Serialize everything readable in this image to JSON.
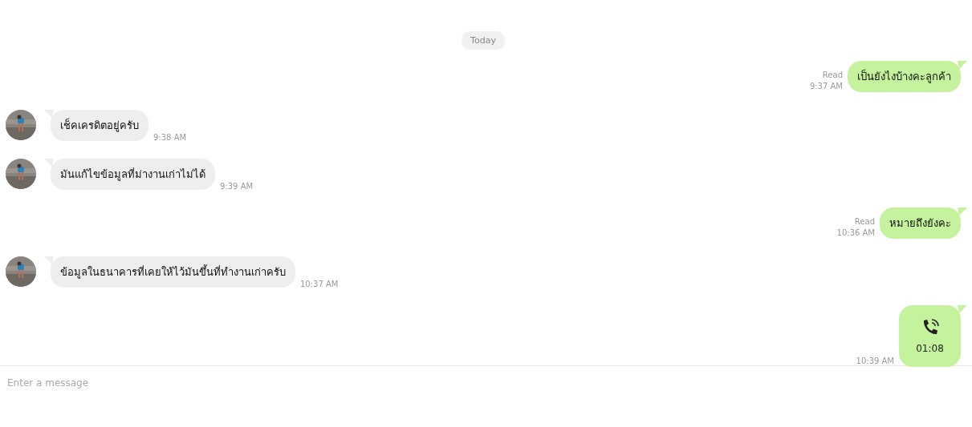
{
  "date_divider": "Today",
  "messages": [
    {
      "kind": "outgoing",
      "text": "เป็นยังไงบ้างคะลูกค้า",
      "status": "Read",
      "time": "9:37 AM"
    },
    {
      "kind": "incoming",
      "text": "เช็คเครดิตอยู่ครับ",
      "time": "9:38 AM"
    },
    {
      "kind": "incoming",
      "text": "มันแก้ไขข้อมูลที่ม่างานเก่าไม่ได้",
      "time": "9:39 AM"
    },
    {
      "kind": "outgoing",
      "text": "หมายถึงยังคะ",
      "status": "Read",
      "time": "10:36 AM"
    },
    {
      "kind": "incoming",
      "text": "ข้อมูลในธนาคารที่เคยให้ไว้มันขึ้นที่ทำงานเก่าครับ",
      "time": "10:37 AM"
    },
    {
      "kind": "call",
      "text": "01:08",
      "time": "10:39 AM"
    }
  ],
  "composer": {
    "placeholder": "Enter a message"
  }
}
